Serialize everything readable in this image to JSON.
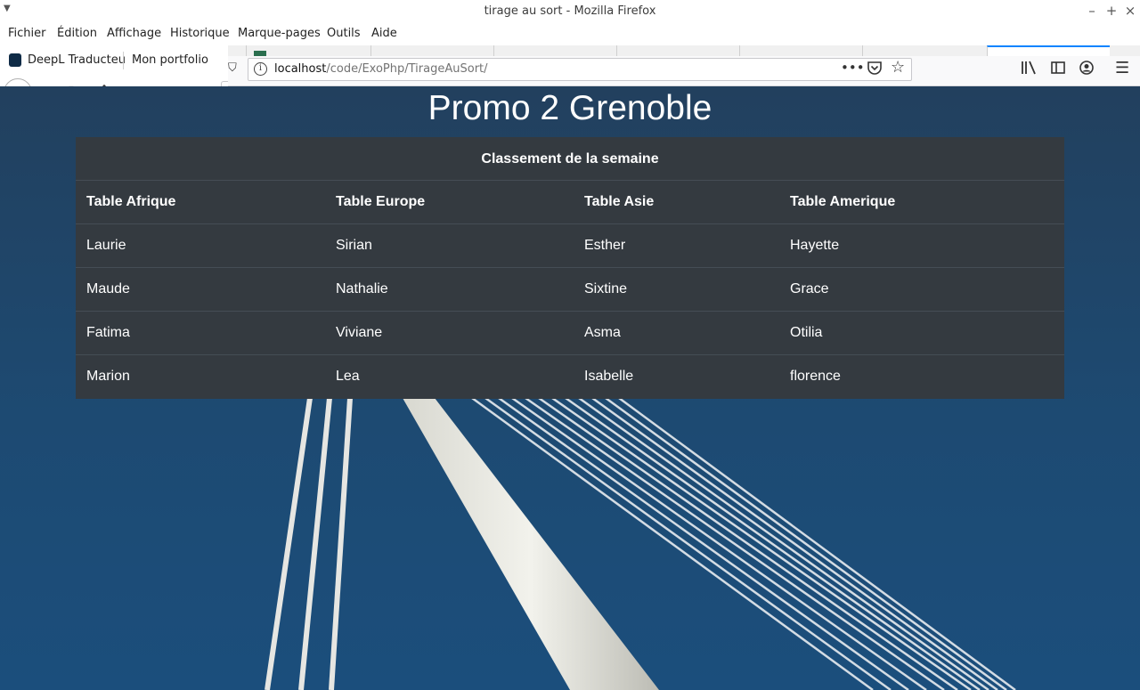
{
  "window": {
    "title": "tirage au sort - Mozilla Firefox"
  },
  "menu": {
    "items": [
      "Fichier",
      "Édition",
      "Affichage",
      "Historique",
      "Marque-pages",
      "Outils",
      "Aide"
    ]
  },
  "bookmarks": {
    "items": [
      "DeepL Traducteu",
      "Mon portfolio"
    ]
  },
  "urlbar": {
    "host": "localhost",
    "path": "/code/ExoPhp/TirageAuSort/"
  },
  "page": {
    "title": "Promo 2 Grenoble",
    "table": {
      "caption": "Classement de la semaine",
      "headers": [
        "Table Afrique",
        "Table Europe",
        "Table Asie",
        "Table Amerique"
      ],
      "rows": [
        [
          "Laurie",
          "Sirian",
          "Esther",
          "Hayette"
        ],
        [
          "Maude",
          "Nathalie",
          "Sixtine",
          "Grace"
        ],
        [
          "Fatima",
          "Viviane",
          "Asma",
          "Otilia"
        ],
        [
          "Marion",
          "Lea",
          "Isabelle",
          "florence"
        ]
      ]
    }
  },
  "icons": {
    "back": "back-arrow-icon",
    "forward": "forward-arrow-icon",
    "reload": "reload-icon",
    "home": "home-icon",
    "info": "info-icon",
    "more": "more-dots-icon",
    "pocket": "pocket-icon",
    "bookmark_star": "star-icon",
    "library": "library-icon",
    "sidebar": "sidebar-icon",
    "account": "account-icon",
    "hamburger": "hamburger-menu-icon"
  },
  "colors": {
    "table_bg": "#343a40",
    "page_bg": "#1d4a72",
    "accent": "#0a84ff"
  }
}
